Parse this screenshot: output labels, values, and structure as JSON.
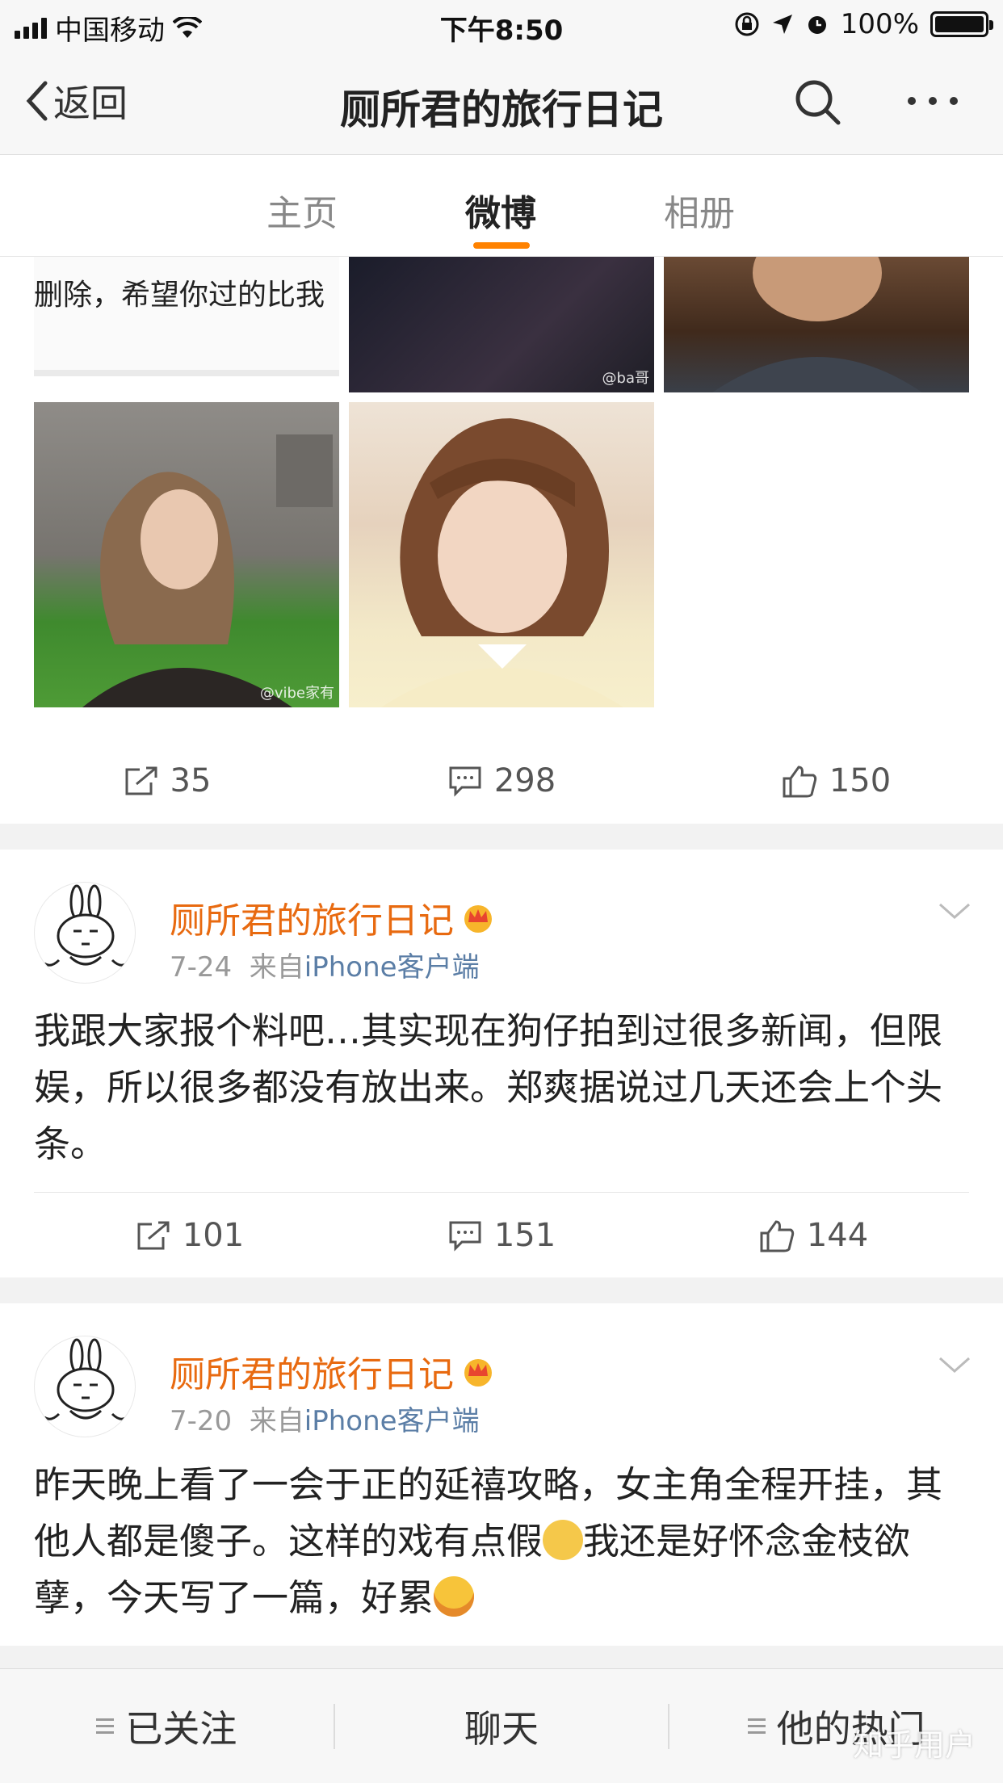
{
  "status_bar": {
    "carrier": "中国移动",
    "time": "下午8:50",
    "battery": "100%",
    "battery_level": 1.0
  },
  "nav": {
    "back_label": "返回",
    "title": "厕所君的旅行日记"
  },
  "tabs": [
    {
      "label": "主页",
      "active": false
    },
    {
      "label": "微博",
      "active": true
    },
    {
      "label": "相册",
      "active": false
    }
  ],
  "first_post": {
    "text_image_snippet": "删除，希望你过的比我",
    "watermarks": [
      "@ba哥",
      "@vibe家有"
    ],
    "actions": {
      "repost": "35",
      "comment": "298",
      "like": "150"
    }
  },
  "posts": [
    {
      "author": "厕所君的旅行日记",
      "date": "7-24",
      "source_prefix": "来自",
      "source": "iPhone客户端",
      "text": "我跟大家报个料吧…其实现在狗仔拍到过很多新闻，但限娱，所以很多都没有放出来。郑爽据说过几天还会上个头条。",
      "actions": {
        "repost": "101",
        "comment": "151",
        "like": "144"
      }
    },
    {
      "author": "厕所君的旅行日记",
      "date": "7-20",
      "source_prefix": "来自",
      "source": "iPhone客户端",
      "text_part1": "昨天晚上看了一会于正的延禧攻略，女主角全程开挂，其他人都是傻子。这样的戏有点假",
      "text_part2": "我还是好怀念金枝欲孽，今天写了一篇，好累"
    }
  ],
  "bottom_bar": {
    "followed": "已关注",
    "chat": "聊天",
    "hot": "他的热门"
  },
  "watermark": "知乎用户",
  "colors": {
    "accent": "#ff8200",
    "username": "#e86a10",
    "source_link": "#5b7ea6"
  }
}
